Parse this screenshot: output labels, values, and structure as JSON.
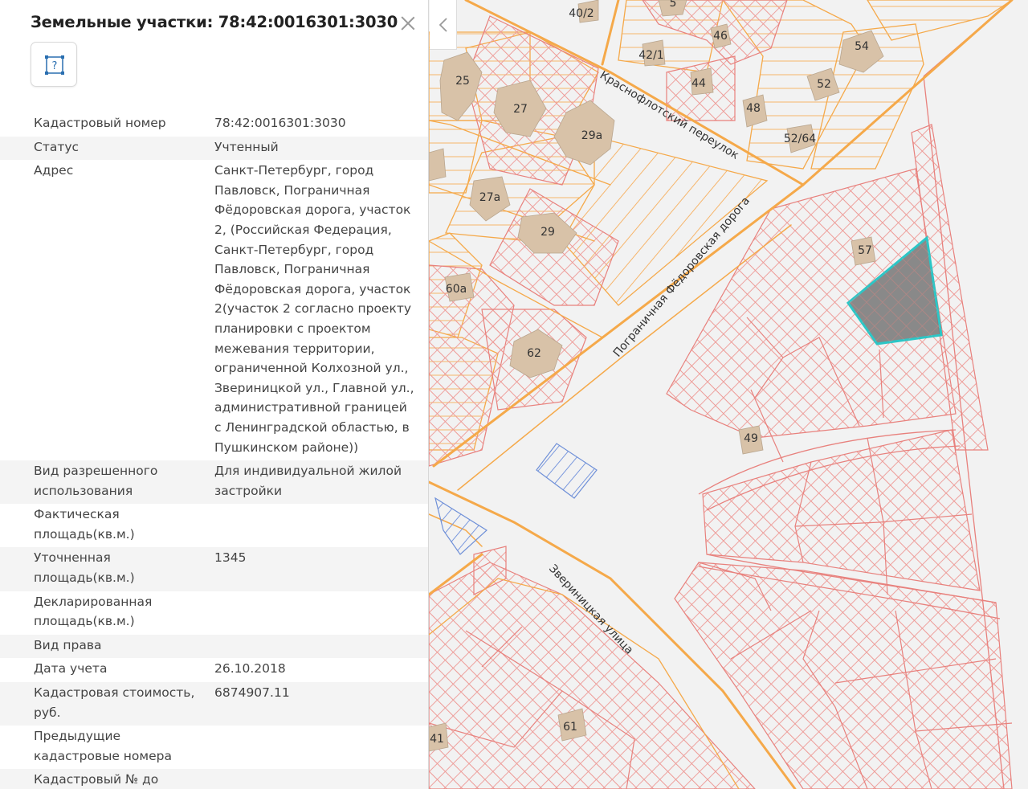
{
  "panel": {
    "title": "Земельные участки: 78:42:0016301:3030",
    "tool_icon": "?",
    "rows": [
      {
        "key": "Кадастровый номер",
        "value": "78:42:0016301:3030"
      },
      {
        "key": "Статус",
        "value": "Учтенный"
      },
      {
        "key": "Адрес",
        "value": "Санкт-Петербург, город Павловск, Пограничная Фёдоровская дорога, участок 2, (Российская Федерация, Санкт-Петербург, город Павловск, Пограничная Фёдоровская дорога, участок 2(участок 2 согласно проекту планировки с проектом межевания территории, ограниченной Колхозной ул., Звериницкой ул., Главной ул., административной границей с Ленинградской областью, в Пушкинском районе))"
      },
      {
        "key": "Вид разрешенного использования",
        "value": "Для индивидуальной жилой застройки"
      },
      {
        "key": "Фактическая площадь(кв.м.)",
        "value": ""
      },
      {
        "key": "Уточненная площадь(кв.м.)",
        "value": "1345"
      },
      {
        "key": "Декларированная площадь(кв.м.)",
        "value": ""
      },
      {
        "key": "Вид права",
        "value": ""
      },
      {
        "key": "Дата учета",
        "value": "26.10.2018"
      },
      {
        "key": "Кадастровая стоимость, руб.",
        "value": "6874907.11"
      },
      {
        "key": "Предыдущие кадастровые номера",
        "value": ""
      },
      {
        "key": "Кадастровый № до",
        "value": ""
      }
    ]
  },
  "map": {
    "streets": {
      "krasnoflotsky": "Краснофлотский переулок",
      "pogranichnaya": "Пограничная Фёдоровская дорога",
      "zverinitskaya": "Звериницкая улица"
    },
    "labels": [
      "40/2",
      "5",
      "46",
      "54",
      "42/1",
      "44",
      "52",
      "48",
      "25",
      "27",
      "29а",
      "52/64",
      "27а",
      "29",
      "57",
      "60а",
      "62",
      "49",
      "61",
      "41"
    ],
    "colors": {
      "road": "#f5a94a",
      "parcel_line": "#e8817d",
      "selected_fill": "#7a7a7a",
      "selected_stroke": "#2cc6c6",
      "building": "#d8c2a8",
      "blue_parcel": "#6f90d8"
    }
  }
}
